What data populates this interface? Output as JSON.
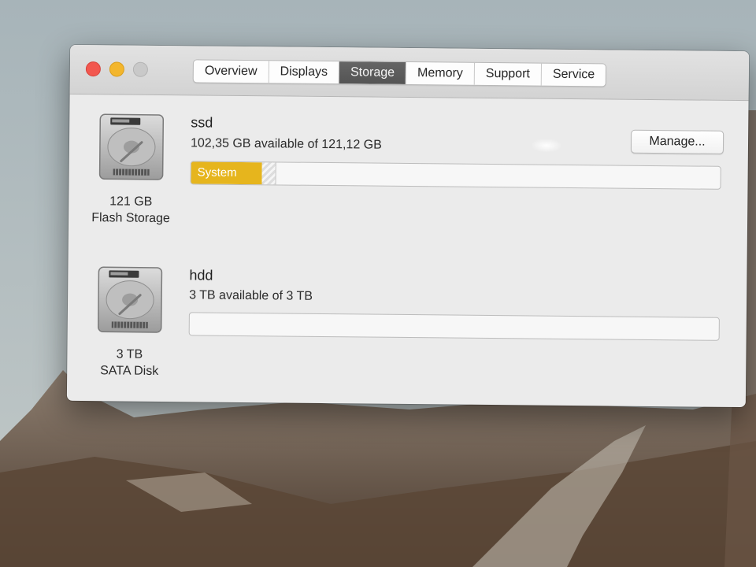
{
  "window": {
    "tabs": [
      {
        "label": "Overview",
        "active": false
      },
      {
        "label": "Displays",
        "active": false
      },
      {
        "label": "Storage",
        "active": true
      },
      {
        "label": "Memory",
        "active": false
      },
      {
        "label": "Support",
        "active": false
      },
      {
        "label": "Service",
        "active": false
      }
    ]
  },
  "drives": [
    {
      "name": "ssd",
      "info": "102,35 GB available of 121,12 GB",
      "capacity": "121 GB",
      "type": "Flash Storage",
      "segments": [
        {
          "label": "System",
          "color": "#e6b51d",
          "fraction": 0.134
        }
      ],
      "icon": "hard-drive-icon"
    },
    {
      "name": "hdd",
      "info": "3 TB available of 3 TB",
      "capacity": "3 TB",
      "type": "SATA Disk",
      "segments": [],
      "icon": "hard-drive-icon"
    }
  ],
  "buttons": {
    "manage": "Manage..."
  },
  "colors": {
    "close": "#f2574f",
    "minimize": "#f3b62d",
    "zoom": "#c9c9c9",
    "active_tab": "#5c5c5c",
    "system_segment": "#e6b51d"
  }
}
